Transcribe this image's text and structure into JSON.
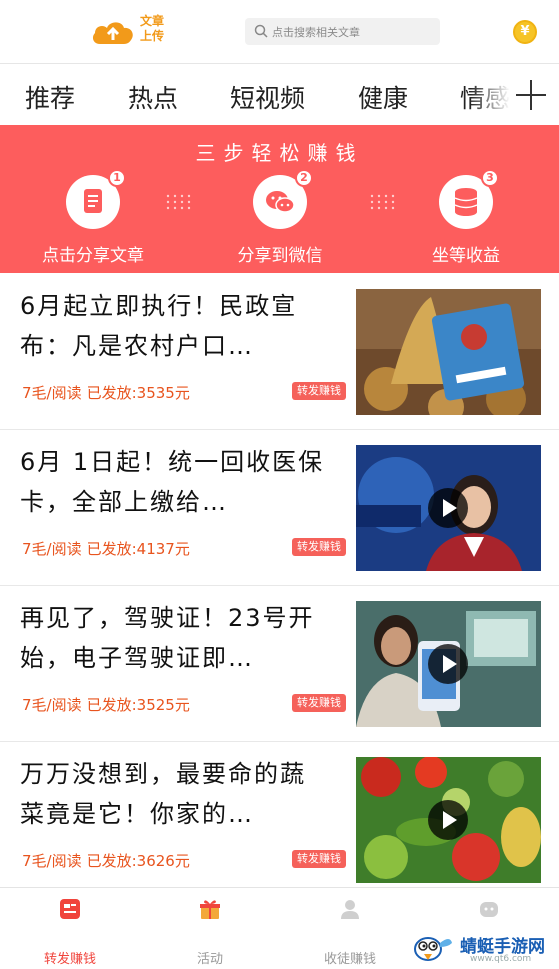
{
  "header": {
    "logo_line1": "文章",
    "logo_line2": "上传",
    "search_placeholder": "点击搜索相关文章",
    "coin_symbol": "¥"
  },
  "tabs": [
    {
      "label": "推荐",
      "active": true
    },
    {
      "label": "热点"
    },
    {
      "label": "短视频"
    },
    {
      "label": "健康"
    },
    {
      "label": "情感"
    }
  ],
  "banner": {
    "title": "三步轻松赚钱",
    "steps": [
      {
        "number": "1",
        "label": "点击分享文章",
        "icon": "document-icon"
      },
      {
        "number": "2",
        "label": "分享到微信",
        "icon": "wechat-icon"
      },
      {
        "number": "3",
        "label": "坐等收益",
        "icon": "coins-icon"
      }
    ],
    "background": "#fd5d5d"
  },
  "articles": [
    {
      "title": "6月起立即执行！民政宣布：凡是农村户口…",
      "rate": "7毛/阅读",
      "paid": "已发放:3535元",
      "badge": "转发赚钱",
      "video": false,
      "thumb": "social-security-card-image"
    },
    {
      "title": "6月 1日起！统一回收医保卡，全部上缴给…",
      "rate": "7毛/阅读",
      "paid": "已发放:4137元",
      "badge": "转发赚钱",
      "video": true,
      "thumb": "news-anchor-image"
    },
    {
      "title": "再见了，驾驶证！23号开始，电子驾驶证即…",
      "rate": "7毛/阅读",
      "paid": "已发放:3525元",
      "badge": "转发赚钱",
      "video": true,
      "thumb": "woman-holding-phone-image"
    },
    {
      "title": "万万没想到，最要命的蔬菜竟是它！你家的…",
      "rate": "7毛/阅读",
      "paid": "已发放:3626元",
      "badge": "转发赚钱",
      "video": true,
      "thumb": "vegetables-image"
    }
  ],
  "bottom_nav": [
    {
      "label": "转发赚钱",
      "icon": "share-money-icon",
      "active": true
    },
    {
      "label": "活动",
      "icon": "gift-icon"
    },
    {
      "label": "收徒赚钱",
      "icon": "user-icon"
    },
    {
      "label": "",
      "icon": "chat-bot-icon"
    }
  ],
  "watermark": {
    "text": "蜻蜓手游网",
    "url": "www.qt6.com"
  },
  "colors": {
    "accent": "#f0443c",
    "price": "#e8541e",
    "banner": "#fd5d5d"
  }
}
